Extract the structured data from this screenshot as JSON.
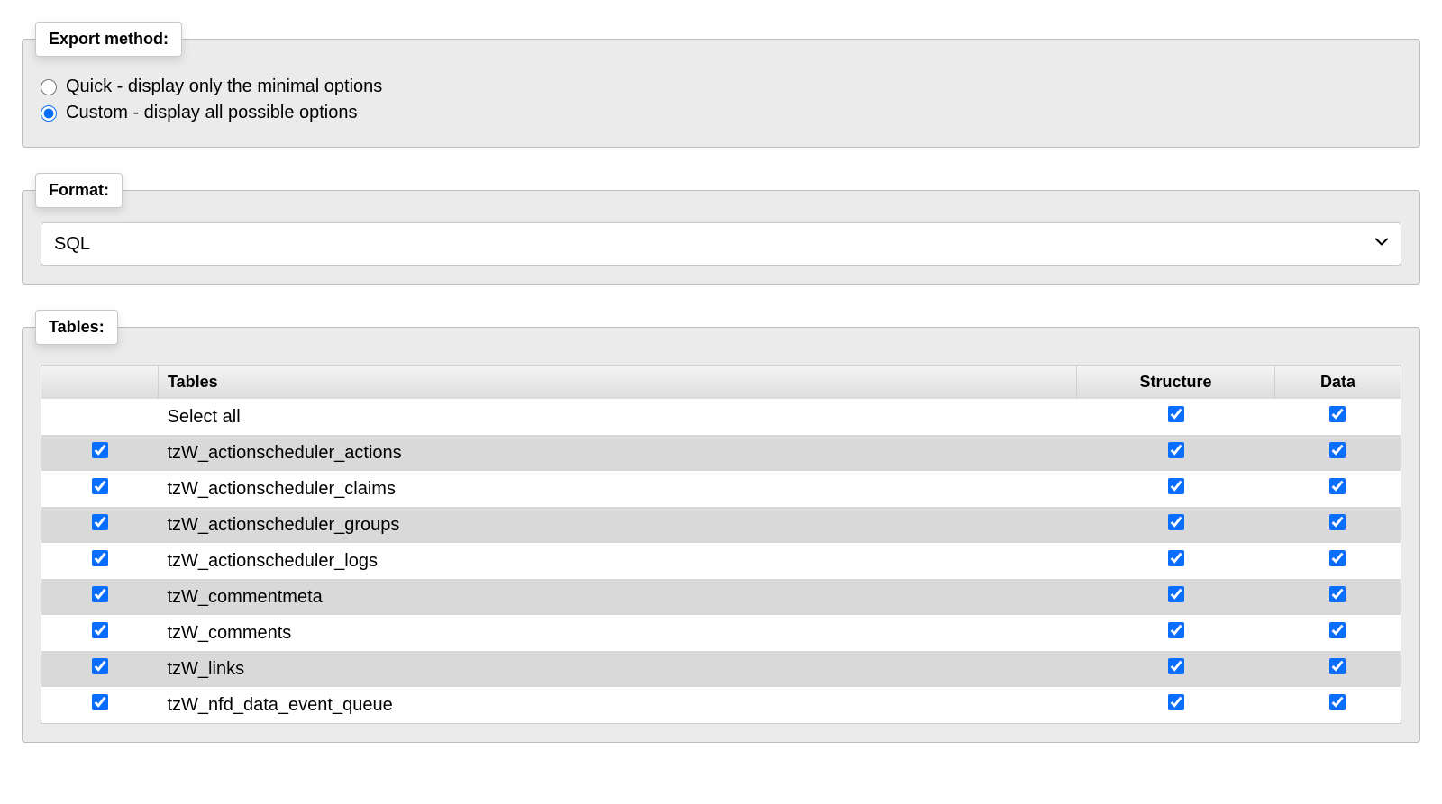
{
  "export_method": {
    "legend": "Export method:",
    "options": {
      "quick": {
        "label": "Quick - display only the minimal options",
        "checked": false
      },
      "custom": {
        "label": "Custom - display all possible options",
        "checked": true
      }
    }
  },
  "format": {
    "legend": "Format:",
    "selected": "SQL"
  },
  "tables": {
    "legend": "Tables:",
    "headers": {
      "tables": "Tables",
      "structure": "Structure",
      "data": "Data"
    },
    "select_all": {
      "label": "Select all",
      "structure_checked": true,
      "data_checked": true
    },
    "rows": [
      {
        "name": "tzW_actionscheduler_actions",
        "selected": true,
        "structure": true,
        "data": true
      },
      {
        "name": "tzW_actionscheduler_claims",
        "selected": true,
        "structure": true,
        "data": true
      },
      {
        "name": "tzW_actionscheduler_groups",
        "selected": true,
        "structure": true,
        "data": true
      },
      {
        "name": "tzW_actionscheduler_logs",
        "selected": true,
        "structure": true,
        "data": true
      },
      {
        "name": "tzW_commentmeta",
        "selected": true,
        "structure": true,
        "data": true
      },
      {
        "name": "tzW_comments",
        "selected": true,
        "structure": true,
        "data": true
      },
      {
        "name": "tzW_links",
        "selected": true,
        "structure": true,
        "data": true
      },
      {
        "name": "tzW_nfd_data_event_queue",
        "selected": true,
        "structure": true,
        "data": true
      }
    ]
  }
}
